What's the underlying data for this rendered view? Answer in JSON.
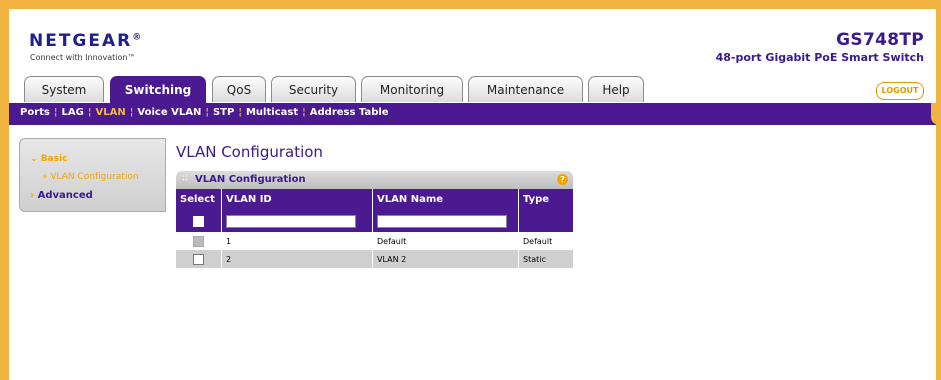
{
  "header": {
    "logo": "NETGEAR",
    "logo_mark": "®",
    "tagline": "Connect with Innovation™",
    "model": "GS748TP",
    "model_desc": "48-port Gigabit PoE Smart Switch",
    "logout": "LOGOUT"
  },
  "tabs": [
    {
      "label": "System"
    },
    {
      "label": "Switching"
    },
    {
      "label": "QoS"
    },
    {
      "label": "Security"
    },
    {
      "label": "Monitoring"
    },
    {
      "label": "Maintenance"
    },
    {
      "label": "Help"
    }
  ],
  "subnav": [
    {
      "label": "Ports"
    },
    {
      "label": "LAG"
    },
    {
      "label": "VLAN"
    },
    {
      "label": "Voice VLAN"
    },
    {
      "label": "STP"
    },
    {
      "label": "Multicast"
    },
    {
      "label": "Address Table"
    }
  ],
  "sidebar": {
    "basic": "Basic",
    "basic_item": "VLAN Configuration",
    "advanced": "Advanced"
  },
  "page_title": "VLAN Configuration",
  "panel": {
    "title": "VLAN Configuration",
    "help": "?",
    "columns": [
      "Select",
      "VLAN ID",
      "VLAN Name",
      "Type"
    ],
    "rows": [
      {
        "id": "1",
        "name": "Default",
        "type": "Default"
      },
      {
        "id": "2",
        "name": "VLAN 2",
        "type": "Static"
      }
    ]
  },
  "colors": {
    "accent_purple": "#4b1a91",
    "accent_orange": "#f2b441"
  }
}
